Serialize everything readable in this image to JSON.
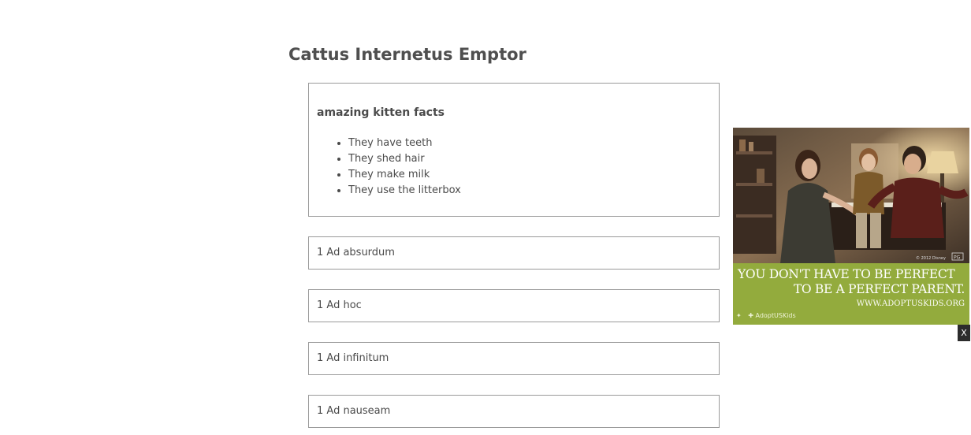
{
  "page": {
    "title": "Cattus Internetus Emptor"
  },
  "facts": {
    "heading": "amazing kitten facts",
    "items": [
      "They have teeth",
      "They shed hair",
      "They make milk",
      "They use the litterbox"
    ]
  },
  "items": [
    "1 Ad absurdum",
    "1 Ad hoc",
    "1 Ad infinitum",
    "1 Ad nauseam"
  ],
  "ad": {
    "line1": "YOU DON'T HAVE TO BE PERFECT",
    "line2": "TO BE A PERFECT PARENT.",
    "url": "WWW.ADOPTUSKIDS.ORG",
    "sponsor": "AdoptUSKids",
    "photo_credit": "© 2012 Disney",
    "rating": "PG",
    "close_label": "X",
    "colors": {
      "footer": "#93ab3d",
      "close_bg": "#2c2c2c"
    }
  }
}
